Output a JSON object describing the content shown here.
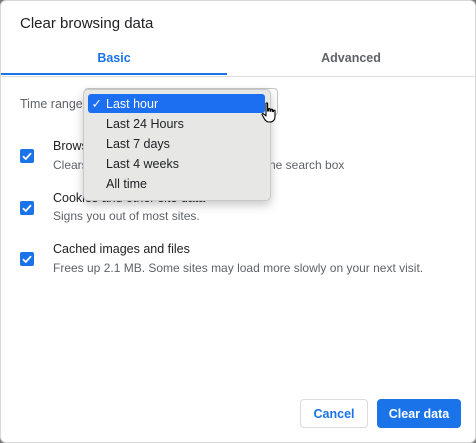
{
  "dialog": {
    "title": "Clear browsing data"
  },
  "tabs": [
    {
      "label": "Basic",
      "selected": true
    },
    {
      "label": "Advanced",
      "selected": false
    }
  ],
  "time_range": {
    "label": "Time range",
    "selected": "Last hour",
    "options": [
      "Last hour",
      "Last 24 Hours",
      "Last 7 days",
      "Last 4 weeks",
      "All time"
    ],
    "check_mark": "✓"
  },
  "items": [
    {
      "title": "Brows",
      "description_start": "Clears",
      "description_end": "ne search box",
      "checked": true
    },
    {
      "title": "Cookies and other site data",
      "description": "Signs you out of most sites.",
      "checked": true
    },
    {
      "title": "Cached images and files",
      "description": "Frees up 2.1 MB. Some sites may load more slowly on your next visit.",
      "checked": true
    }
  ],
  "buttons": {
    "cancel": "Cancel",
    "clear": "Clear data"
  },
  "colors": {
    "accent": "#1a73e8",
    "menu_highlight": "#1b6ff0",
    "menu_background": "#e7e8e6"
  },
  "icons": {
    "checkbox": "checkmark-icon",
    "cursor": "hand-pointer-icon"
  }
}
